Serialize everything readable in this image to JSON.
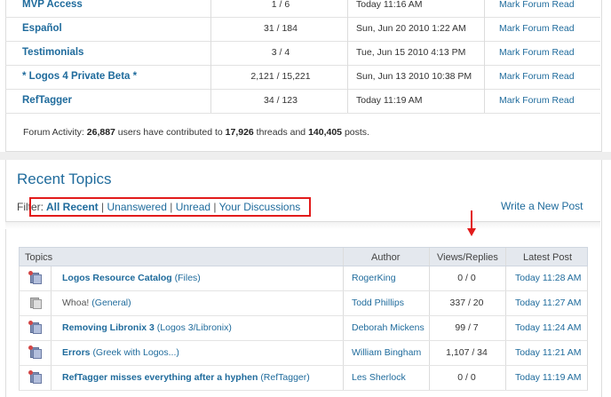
{
  "forums": [
    {
      "name": "MVP Access",
      "count": "1 / 6",
      "date": "Today 11:16 AM",
      "action": "Mark Forum Read"
    },
    {
      "name": "Español",
      "count": "31 / 184",
      "date": "Sun, Jun 20 2010 1:22 AM",
      "action": "Mark Forum Read"
    },
    {
      "name": "Testimonials",
      "count": "3 / 4",
      "date": "Tue, Jun 15 2010 4:13 PM",
      "action": "Mark Forum Read"
    },
    {
      "name": "* Logos 4 Private Beta *",
      "count": "2,121 / 15,221",
      "date": "Sun, Jun 13 2010 10:38 PM",
      "action": "Mark Forum Read"
    },
    {
      "name": "RefTagger",
      "count": "34 / 123",
      "date": "Today 11:19 AM",
      "action": "Mark Forum Read"
    }
  ],
  "activity": {
    "prefix": "Forum Activity: ",
    "users": "26,887",
    "mid1": " users have contributed to ",
    "threads": "17,926",
    "mid2": " threads and ",
    "posts": "140,405",
    "suffix": " posts."
  },
  "recent": {
    "title": "Recent Topics",
    "filter_label": "Filter:",
    "filters": [
      "All Recent",
      "Unanswered",
      "Unread",
      "Your Discussions"
    ],
    "separator": "|",
    "new_post": "Write a New Post"
  },
  "table": {
    "headers": {
      "topics": "Topics",
      "author": "Author",
      "views": "Views/Replies",
      "latest": "Latest Post"
    },
    "rows": [
      {
        "title": "Logos Resource Catalog",
        "category": "(Files)",
        "author": "RogerKing",
        "views": "0 / 0",
        "latest": "Today 11:28 AM",
        "unread": true
      },
      {
        "title": "Whoa!",
        "category": "(General)",
        "author": "Todd Phillips",
        "views": "337 / 20",
        "latest": "Today 11:27 AM",
        "unread": false
      },
      {
        "title": "Removing Libronix 3",
        "category": "(Logos 3/Libronix)",
        "author": "Deborah Mickens",
        "views": "99 / 7",
        "latest": "Today 11:24 AM",
        "unread": true
      },
      {
        "title": "Errors",
        "category": "(Greek with Logos...)",
        "author": "William Bingham",
        "views": "1,107 / 34",
        "latest": "Today 11:21 AM",
        "unread": true
      },
      {
        "title": "RefTagger misses everything after a hyphen",
        "category": "(RefTagger)",
        "author": "Les Sherlock",
        "views": "0 / 0",
        "latest": "Today 11:19 AM",
        "unread": true
      }
    ]
  },
  "colors": {
    "link": "#1f6b9c",
    "highlight_box": "#e21b1b",
    "header_bg": "#e4e8ee"
  }
}
